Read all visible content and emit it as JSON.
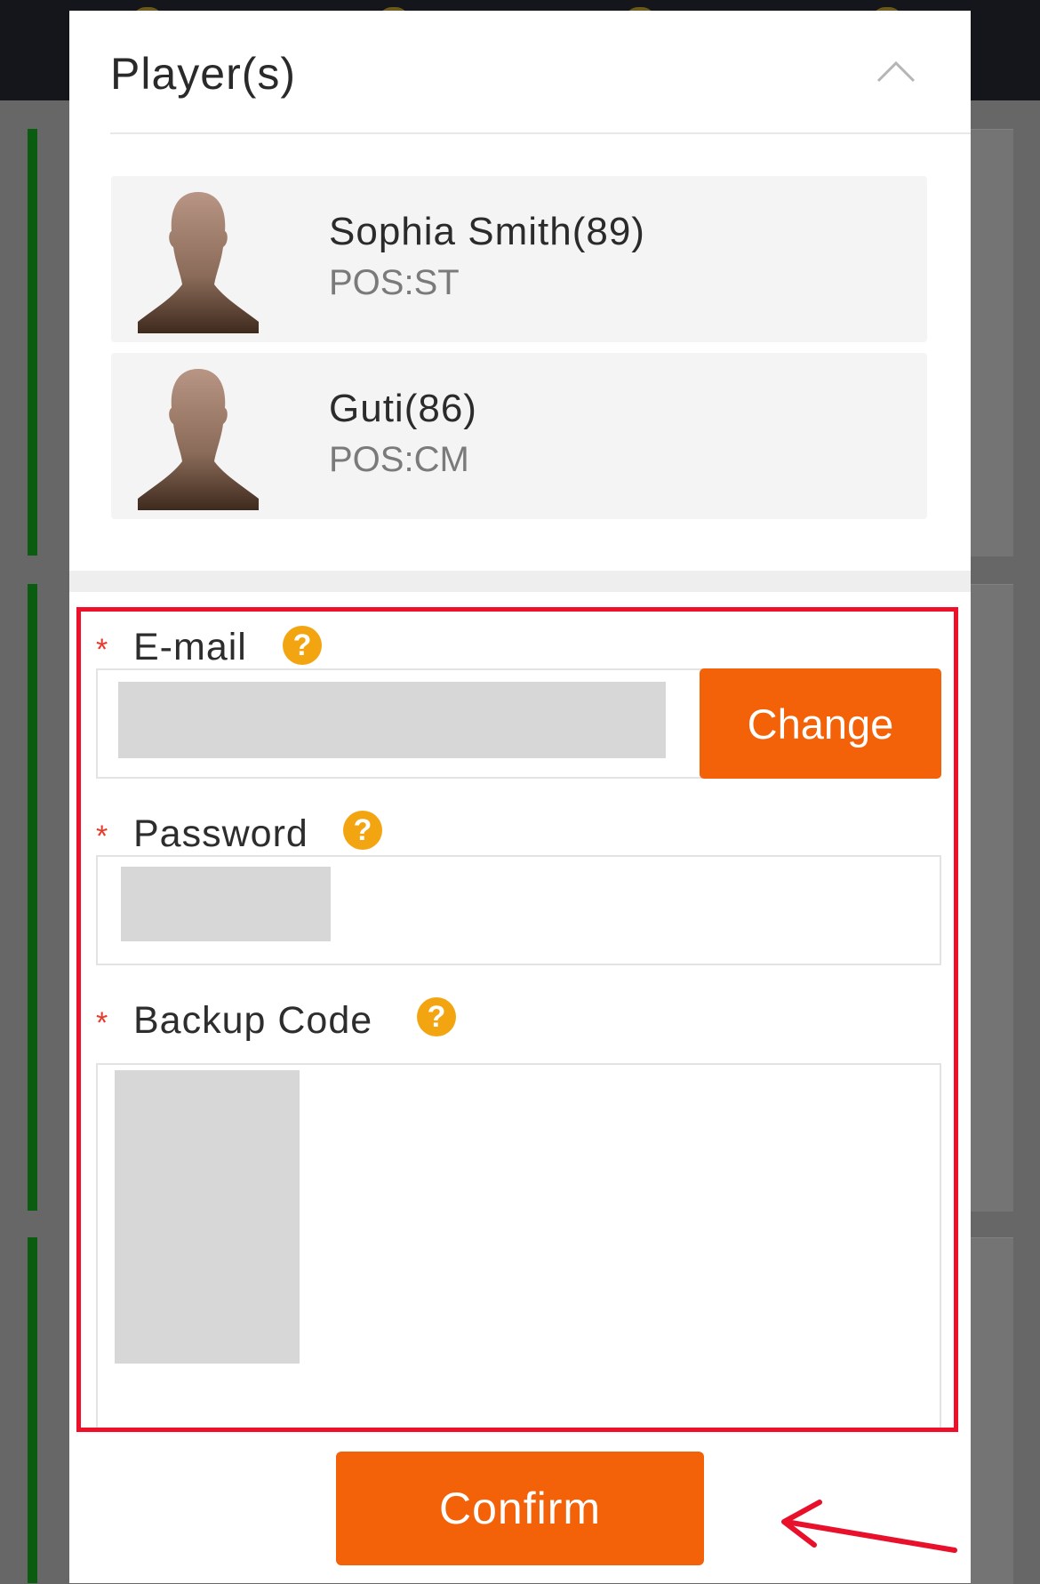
{
  "modal": {
    "title": "Player(s)"
  },
  "players": [
    {
      "name": "Sophia Smith(89)",
      "position": "POS:ST"
    },
    {
      "name": "Guti(86)",
      "position": "POS:CM"
    }
  ],
  "form": {
    "email": {
      "required_mark": "*",
      "label": "E-mail",
      "help_glyph": "?",
      "change_label": "Change"
    },
    "password": {
      "required_mark": "*",
      "label": "Password",
      "help_glyph": "?"
    },
    "backup_code": {
      "required_mark": "*",
      "label": "Backup Code",
      "help_glyph": "?"
    },
    "confirm_label": "Confirm"
  },
  "colors": {
    "accent": "#f36109",
    "highlight": "#ee0f2a",
    "help_icon": "#f2a511",
    "required": "#e83a2a"
  }
}
